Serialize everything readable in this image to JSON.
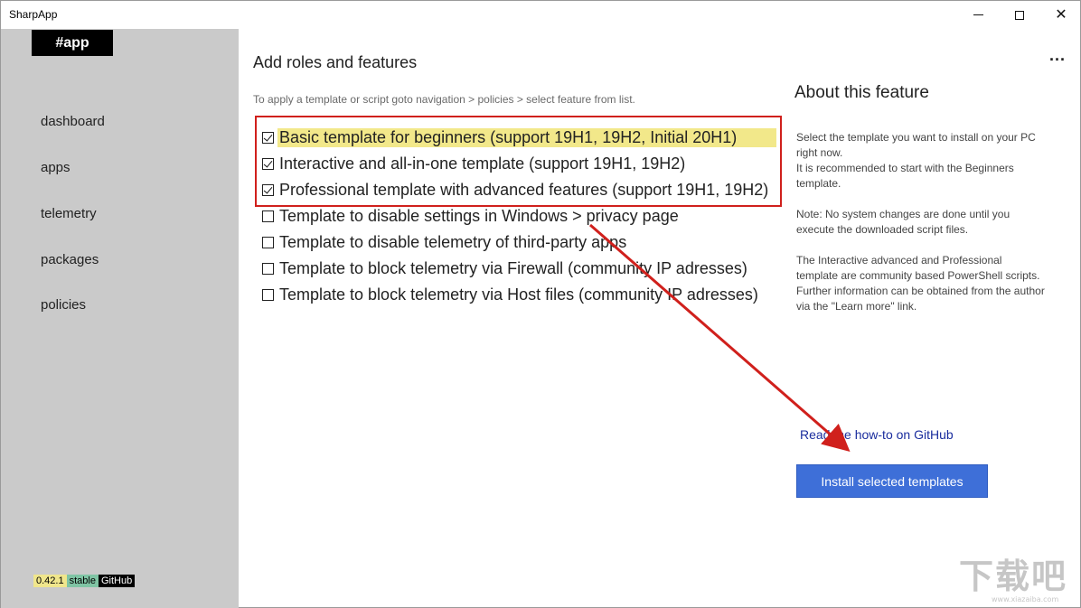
{
  "window": {
    "title": "SharpApp"
  },
  "sidebar": {
    "brand": "#app",
    "items": [
      {
        "label": "dashboard"
      },
      {
        "label": "apps"
      },
      {
        "label": "telemetry"
      },
      {
        "label": "packages"
      },
      {
        "label": "policies"
      }
    ],
    "badges": {
      "version": "0.42.1",
      "channel": "stable",
      "repo": "GitHub"
    }
  },
  "main": {
    "title": "Add roles and features",
    "hint": "To apply a template or script goto navigation > policies > select feature from list.",
    "menu": "...",
    "features": [
      {
        "label": "Basic template for beginners (support 19H1, 19H2, Initial 20H1)",
        "checked": true,
        "highlighted": true
      },
      {
        "label": "Interactive and all-in-one template (support 19H1, 19H2)",
        "checked": true
      },
      {
        "label": "Professional template with advanced features (support 19H1, 19H2)",
        "checked": true
      },
      {
        "label": "Template to disable settings in Windows > privacy page",
        "checked": false
      },
      {
        "label": "Template to disable telemetry of third-party apps",
        "checked": false
      },
      {
        "label": "Template to block telemetry via Firewall (community IP adresses)",
        "checked": false
      },
      {
        "label": "Template to block telemetry via Host files (community IP adresses)",
        "checked": false
      }
    ]
  },
  "about": {
    "title": "About this feature",
    "paragraphs": [
      "Select the template you want to install on your PC right now.\nIt is recommended to start with the Beginners template.",
      "Note: No system changes are done until you execute the downloaded script files.",
      "The Interactive advanced and Professional template are community based PowerShell scripts. Further information can be obtained from the author via the \"Learn more\" link."
    ],
    "link": "Read the how-to on GitHub",
    "install_button": "Install selected templates"
  },
  "watermark": {
    "text": "下载吧",
    "url": "www.xiazaiba.com"
  },
  "colors": {
    "sidebar": "#cacaca",
    "accent": "#3e6fd8",
    "highlight": "#f2e88a",
    "annotation": "#d0201c"
  }
}
